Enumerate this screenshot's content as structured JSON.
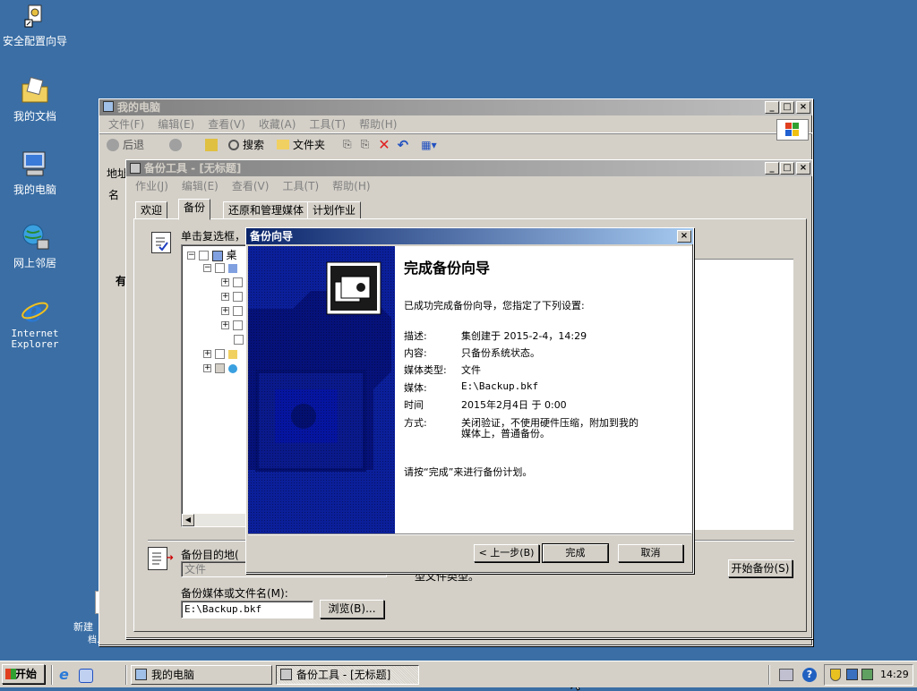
{
  "desktop_icons": [
    {
      "label": "安全配置向导",
      "icon": "security-wizard-icon"
    },
    {
      "label": "我的文档",
      "icon": "documents-folder-icon"
    },
    {
      "label": "我的电脑",
      "icon": "computer-icon"
    },
    {
      "label": "网上邻居",
      "icon": "network-icon"
    },
    {
      "label": "Internet Explorer",
      "icon": "ie-icon"
    },
    {
      "label": "新建",
      "icon": "text-file-icon"
    },
    {
      "label": "档.txt",
      "icon": ""
    }
  ],
  "mycomputer": {
    "title": "我的电脑",
    "menu": [
      "文件(F)",
      "编辑(E)",
      "查看(V)",
      "收藏(A)",
      "工具(T)",
      "帮助(H)"
    ],
    "toolbar": {
      "back": "后退",
      "search": "搜索",
      "folders": "文件夹"
    },
    "address_label": "地址",
    "side_labels": [
      "名",
      "有"
    ]
  },
  "backup": {
    "title": "备份工具 - [无标题]",
    "menu": [
      "作业(J)",
      "编辑(E)",
      "查看(V)",
      "工具(T)",
      "帮助(H)"
    ],
    "tabs": [
      "欢迎",
      "备份",
      "还原和管理媒体",
      "计划作业"
    ],
    "select_label": "单击复选框，",
    "tree_root": "桌",
    "dest_label": "备份目的地(",
    "dest_value": "文件",
    "media_label": "备份媒体或文件名(M):",
    "media_value": "E:\\Backup.bkf",
    "browse": "浏览(B)...",
    "start": "开始备份(S)",
    "file_type_note": "型文件类型。"
  },
  "wizard": {
    "title": "备份向导",
    "heading": "完成备份向导",
    "intro": "已成功完成备份向导，您指定了下列设置:",
    "rows": [
      {
        "k": "描述:",
        "v": "集创建于 2015-2-4，14:29"
      },
      {
        "k": "内容:",
        "v": "只备份系统状态。"
      },
      {
        "k": "媒体类型:",
        "v": "文件"
      },
      {
        "k": "媒体:",
        "v": "E:\\Backup.bkf"
      },
      {
        "k": "时间",
        "v": "2015年2月4日 于 0:00"
      },
      {
        "k": "方式:",
        "v": "关闭验证，不使用硬件压缩，附加到我的"
      },
      {
        "k": "",
        "v": "媒体上，普通备份。"
      }
    ],
    "finish_prompt": "请按“完成”来进行备份计划。",
    "back": "< 上一步(B)",
    "finish": "完成",
    "cancel": "取消"
  },
  "taskbar": {
    "start": "开始",
    "items": [
      "我的电脑",
      "备份工具 - [无标题]"
    ],
    "clock": "14:29"
  },
  "colors": {
    "desktop": "#3a6ea5",
    "active_title": "#0a246a",
    "wizard_art": "#0b1f9a"
  }
}
